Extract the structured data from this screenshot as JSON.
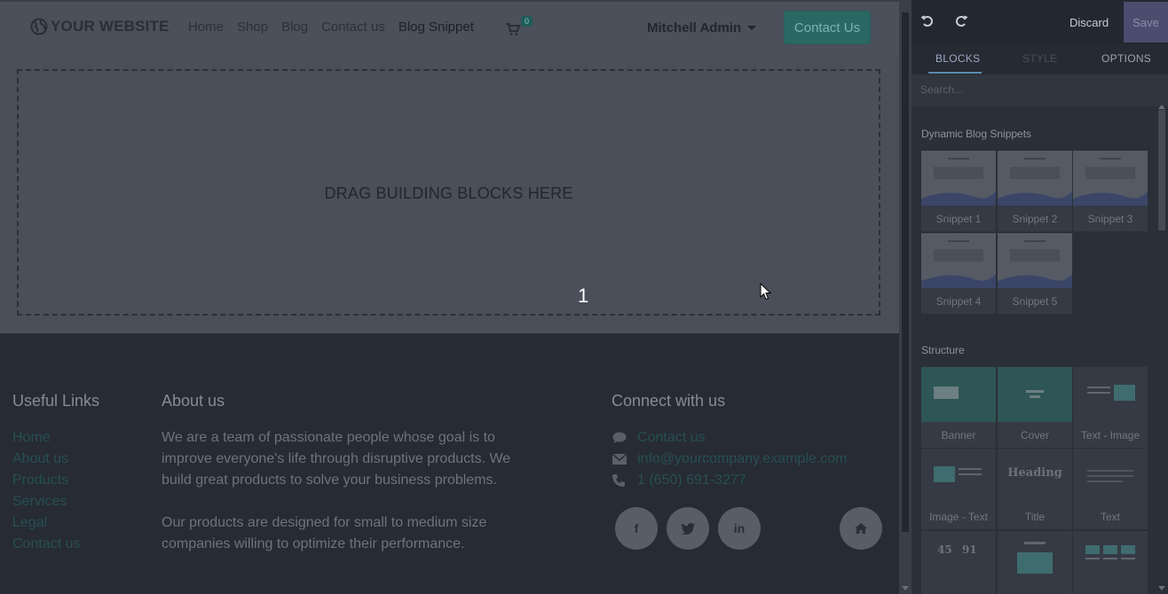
{
  "navbar": {
    "logo_text": "YOUR WEBSITE",
    "links": [
      "Home",
      "Shop",
      "Blog",
      "Contact us",
      "Blog Snippet"
    ],
    "cart_count": "0",
    "user_name": "Mitchell Admin",
    "cta_label": "Contact Us"
  },
  "dropzone": {
    "text": "DRAG BUILDING BLOCKS HERE"
  },
  "step_number": "1",
  "footer": {
    "useful_links_title": "Useful Links",
    "useful_links": [
      "Home",
      "About us",
      "Products",
      "Services",
      "Legal",
      "Contact us"
    ],
    "about_title": "About us",
    "about_p1": "We are a team of passionate people whose goal is to improve everyone's life through disruptive products. We build great products to solve your business problems.",
    "about_p2": "Our products are designed for small to medium size companies willing to optimize their performance.",
    "connect_title": "Connect with us",
    "contact_link": "Contact us",
    "email": "info@yourcompany.example.com",
    "phone": "1 (650) 691-3277",
    "social_icons": [
      "facebook-icon",
      "twitter-icon",
      "linkedin-icon",
      "home-icon"
    ]
  },
  "editor": {
    "discard_label": "Discard",
    "save_label": "Save",
    "tabs": [
      "BLOCKS",
      "STYLE",
      "OPTIONS"
    ],
    "active_tab": "BLOCKS",
    "search_placeholder": "Search...",
    "sections": [
      {
        "title": "Dynamic Blog Snippets",
        "blocks": [
          "Snippet 1",
          "Snippet 2",
          "Snippet 3",
          "Snippet 4",
          "Snippet 5"
        ]
      },
      {
        "title": "Structure",
        "blocks": [
          "Banner",
          "Cover",
          "Text - Image",
          "Image - Text",
          "Title",
          "Text",
          "",
          "",
          ""
        ]
      }
    ],
    "title_block_heading": "Heading",
    "number_block_values": [
      "45",
      "91"
    ]
  },
  "colors": {
    "accent_teal": "#2a6864",
    "link_color": "#264f54",
    "save_bg": "#4b4c6e",
    "overlay_bg": "#4a4f5a"
  }
}
